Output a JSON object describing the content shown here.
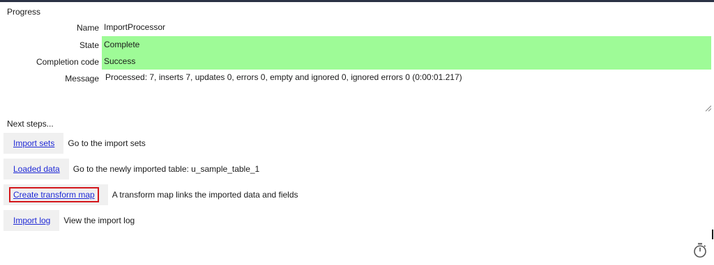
{
  "progress": {
    "title": "Progress",
    "fields": {
      "name": {
        "label": "Name",
        "value": "ImportProcessor"
      },
      "state": {
        "label": "State",
        "value": "Complete"
      },
      "completion_code": {
        "label": "Completion code",
        "value": "Success"
      },
      "message": {
        "label": "Message",
        "value": "Processed: 7, inserts 7, updates 0, errors 0, empty and ignored 0, ignored errors 0  (0:00:01.217)"
      }
    },
    "status_color": "#9efb97"
  },
  "next_steps": {
    "title": "Next steps...",
    "items": [
      {
        "link": "Import sets",
        "description": "Go to the import sets"
      },
      {
        "link": "Loaded data",
        "description": "Go to the newly imported table: u_sample_table_1"
      },
      {
        "link": "Create transform map",
        "description": "A transform map links the imported data and fields"
      },
      {
        "link": "Import log",
        "description": "View the import log"
      }
    ]
  },
  "icons": {
    "resize": "resize-grip-icon",
    "timer": "stopwatch-icon"
  }
}
